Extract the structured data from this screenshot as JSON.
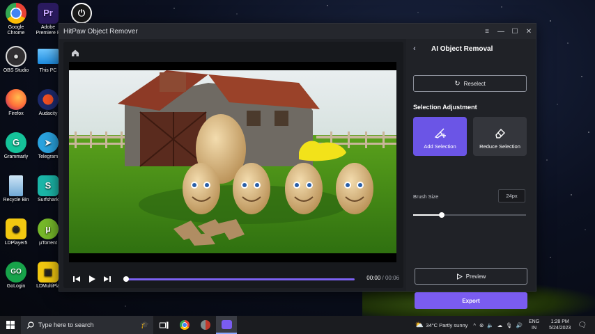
{
  "desktop": {
    "icons": [
      {
        "label": "Google Chrome",
        "icon": "chrome-icon",
        "color": "#ea4335"
      },
      {
        "label": "Adobe Premiere P",
        "icon": "premiere-icon",
        "color": "#2a1a5e"
      },
      {
        "label": "OBS Studio",
        "icon": "obs-icon",
        "color": "#302e31"
      },
      {
        "label": "This PC",
        "icon": "this-pc-icon",
        "color": "#1d8ce0"
      },
      {
        "label": "Firefox",
        "icon": "firefox-icon",
        "color": "#ff7139"
      },
      {
        "label": "Audacity",
        "icon": "audacity-icon",
        "color": "#1d2a6b"
      },
      {
        "label": "Grammarly",
        "icon": "grammarly-icon",
        "color": "#15c39a"
      },
      {
        "label": "Telegram",
        "icon": "telegram-icon",
        "color": "#2aa3df"
      },
      {
        "label": "Recycle Bin",
        "icon": "recycle-bin-icon",
        "color": "#6fa8d6"
      },
      {
        "label": "Surfshark",
        "icon": "surfshark-icon",
        "color": "#1bb6a8"
      },
      {
        "label": "LDPlayer5",
        "icon": "ldplayer-icon",
        "color": "#f2c811"
      },
      {
        "label": "µTorrent",
        "icon": "utorrent-icon",
        "color": "#76b82a"
      },
      {
        "label": "GoLogin",
        "icon": "gologin-icon",
        "color": "#17a34a"
      },
      {
        "label": "LDMultiPla",
        "icon": "ldmultiplayer-icon",
        "color": "#f2c811"
      }
    ],
    "top_icon": "power-icon"
  },
  "window": {
    "title": "HitPaw Object Remover",
    "controls": [
      "≡",
      "—",
      "☐",
      "✕"
    ]
  },
  "player": {
    "current_time": "00:00",
    "separator": " / ",
    "duration": "00:06",
    "progress": 0
  },
  "panel": {
    "title": "AI Object Removal",
    "reselect_label": "Reselect",
    "section_title": "Selection Adjustment",
    "add_selection_label": "Add Selection",
    "reduce_selection_label": "Reduce Selection",
    "brush_size_label": "Brush Size",
    "brush_size_value": "24px",
    "brush_size_level": 0.25,
    "preview_label": "Preview",
    "export_label": "Export"
  },
  "taskbar": {
    "search_placeholder": "Type here to search",
    "weather": "34°C  Partly sunny",
    "language": "ENG",
    "region": "IN",
    "time": "1:28 PM",
    "date": "5/24/2023"
  },
  "colors": {
    "accent": "#7a5cf0",
    "panel_bg": "#202227",
    "window_bg": "#1d1f24"
  }
}
